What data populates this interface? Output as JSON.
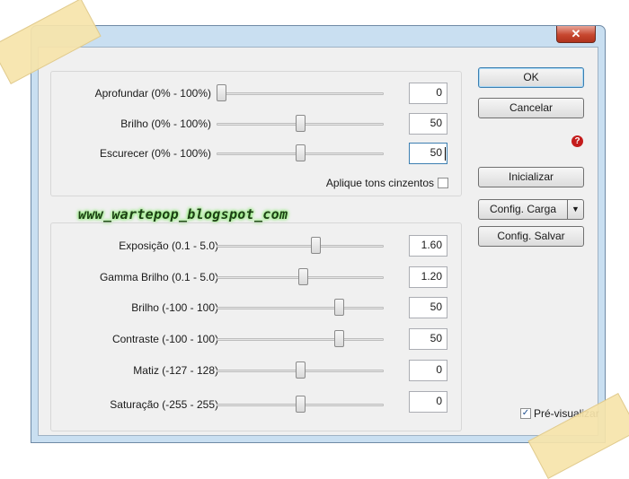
{
  "window": {
    "title": "",
    "close_label": "✕"
  },
  "group1": {
    "sliders": [
      {
        "label": "Aprofundar (0% - 100%)",
        "value": "0",
        "level": 0.0
      },
      {
        "label": "Brilho (0% - 100%)",
        "value": "50",
        "level": 0.5
      },
      {
        "label": "Escurecer (0% - 100%)",
        "value": "50",
        "level": 0.5
      }
    ],
    "grayscale_label": "Aplique tons cinzentos",
    "grayscale_checked": false
  },
  "watermark": "www_wartepop_blogspot_com",
  "group2": {
    "sliders": [
      {
        "label": "Exposição (0.1 - 5.0)",
        "value": "1.60",
        "level": 0.6
      },
      {
        "label": "Gamma Brilho (0.1 - 5.0)",
        "value": "1.20",
        "level": 0.52
      },
      {
        "label": "Brilho (-100 - 100)",
        "value": "50",
        "level": 0.75
      },
      {
        "label": "Contraste (-100 - 100)",
        "value": "50",
        "level": 0.75
      },
      {
        "label": "Matiz (-127 - 128)",
        "value": "0",
        "level": 0.5
      },
      {
        "label": "Saturação (-255 - 255)",
        "value": "0",
        "level": 0.5
      }
    ]
  },
  "buttons": {
    "ok": "OK",
    "cancel": "Cancelar",
    "reset": "Inicializar",
    "load": "Config. Carga",
    "save": "Config. Salvar",
    "dropdown_arrow": "▼"
  },
  "help_icon": "question-icon",
  "preview": {
    "label": "Pré-visualizar",
    "checked": true
  }
}
